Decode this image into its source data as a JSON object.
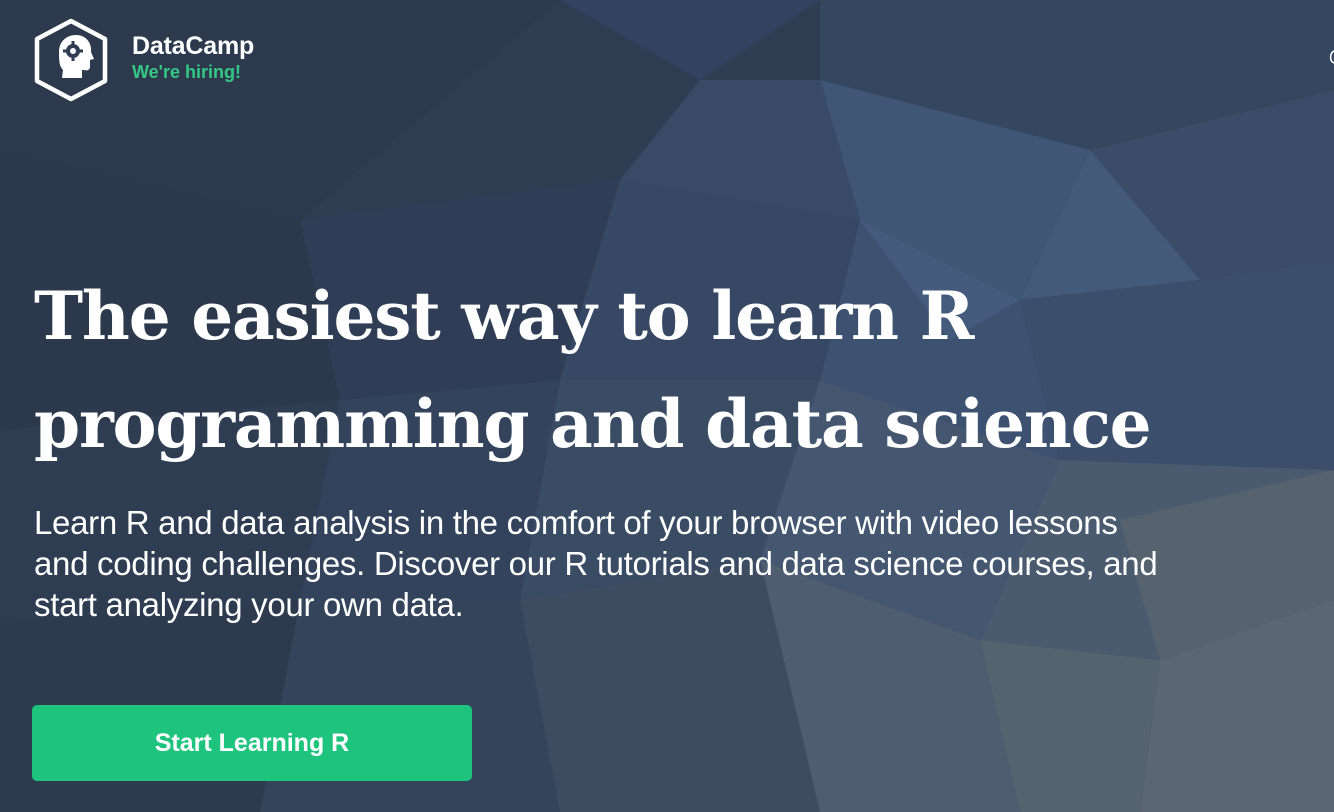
{
  "header": {
    "brand_name": "DataCamp",
    "hiring_link": "We're hiring!",
    "logo_icon": "datacamp-head-hexagon-icon"
  },
  "hero": {
    "headline_line1": "The easiest way to learn R",
    "headline_line2": "programming and data science",
    "subtext_line1": "Learn R and data analysis in the comfort of your browser with video lessons",
    "subtext_line2": "and coding challenges. Discover our R tutorials and data science courses, and",
    "subtext_line3": "start analyzing your own data.",
    "cta_label": "Start Learning R"
  },
  "colors": {
    "background": "#2f3d52",
    "accent_green": "#1ec47e",
    "hiring_green": "#33c884",
    "text": "#ffffff"
  }
}
